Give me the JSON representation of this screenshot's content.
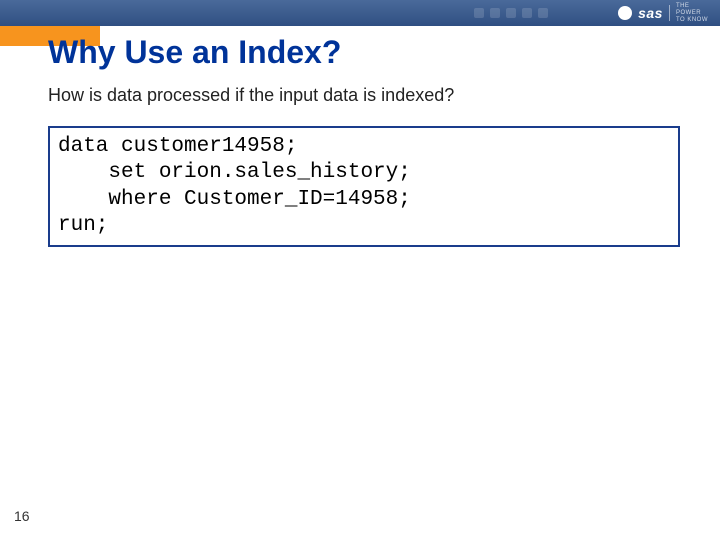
{
  "header": {
    "brand": "sas",
    "tagline_l1": "THE",
    "tagline_l2": "POWER",
    "tagline_l3": "TO KNOW"
  },
  "slide": {
    "title": "Why Use an Index?",
    "subtitle": "How is data processed if the input data is indexed?",
    "code": "data customer14958;\n    set orion.sales_history;\n    where Customer_ID=14958;\nrun;",
    "page_number": "16"
  }
}
